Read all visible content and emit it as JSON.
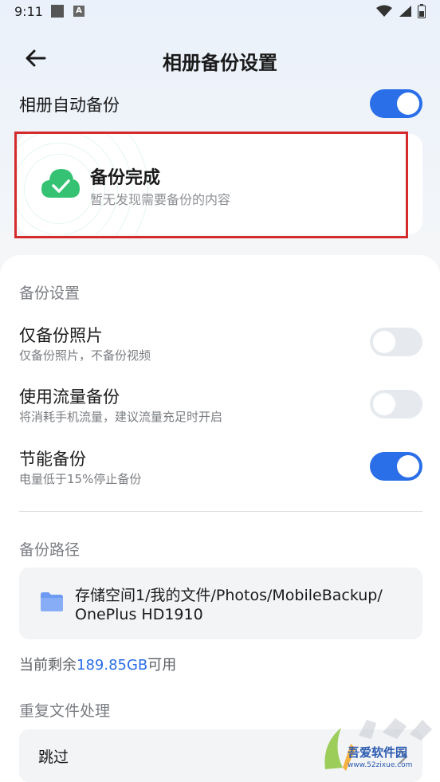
{
  "status_bar": {
    "time": "9:11",
    "icons": [
      "notification-square-icon",
      "a-icon",
      "wifi-icon",
      "signal-icon",
      "battery-icon"
    ]
  },
  "header": {
    "title": "相册备份设置",
    "back_icon": "back-arrow-icon"
  },
  "auto_backup": {
    "label": "相册自动备份",
    "enabled": true
  },
  "status_card": {
    "title": "备份完成",
    "subtitle": "暂无发现需要备份的内容",
    "icon": "cloud-check-icon"
  },
  "backup_settings": {
    "section_title": "备份设置",
    "items": [
      {
        "title": "仅备份照片",
        "subtitle": "仅备份照片，不备份视频",
        "enabled": false
      },
      {
        "title": "使用流量备份",
        "subtitle": "将消耗手机流量，建议流量充足时开启",
        "enabled": false
      },
      {
        "title": "节能备份",
        "subtitle": "电量低于15%停止备份",
        "enabled": true
      }
    ]
  },
  "backup_path": {
    "section_title": "备份路径",
    "path_line1": "存储空间1/我的文件/Photos/MobileBackup/",
    "path_line2": "OnePlus HD1910",
    "icon": "folder-icon",
    "remaining_prefix": "当前剩余",
    "remaining_value": "189.85GB",
    "remaining_suffix": "可用"
  },
  "duplicate": {
    "section_title": "重复文件处理",
    "value": "跳过",
    "icon": "chevron-right-icon"
  },
  "watermark": {
    "text": "吾爱软件园",
    "url": "www.52zixue.com"
  },
  "colors": {
    "accent": "#2a6ee8",
    "success": "#35c272",
    "highlight_border": "#d42c2c"
  }
}
